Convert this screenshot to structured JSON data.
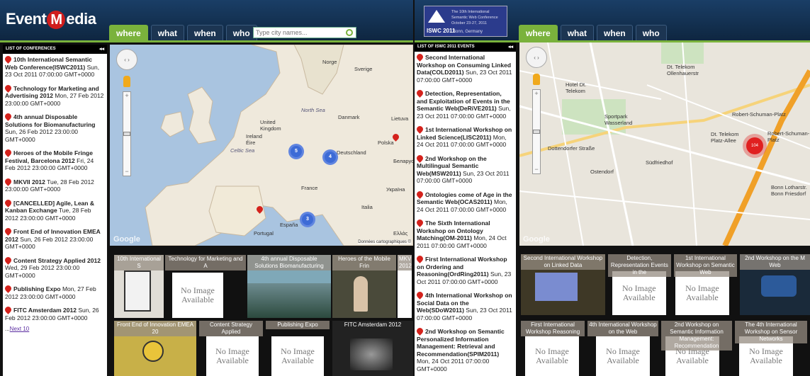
{
  "left": {
    "logo": {
      "pre": "Event",
      "heart": "M",
      "post": "edia"
    },
    "tabs": [
      "where",
      "what",
      "when",
      "who"
    ],
    "active_tab": "where",
    "search": {
      "placeholder": "Type city names..."
    },
    "list_header": "LIST OF CONFERENCES",
    "items": [
      {
        "title": "10th International Semantic Web Conference(ISWC2011)",
        "date": "Sun, 23 Oct 2011 07:00:00 GMT+0000"
      },
      {
        "title": "Technology for Marketing and Advertising 2012",
        "date": "Mon, 27 Feb 2012 23:00:00 GMT+0000"
      },
      {
        "title": "4th annual Disposable Solutions for Biomanufacturing",
        "date": "Sun, 26 Feb 2012 23:00:00 GMT+0000"
      },
      {
        "title": "Heroes of the Mobile Fringe Festival, Barcelona 2012",
        "date": "Fri, 24 Feb 2012 23:00:00 GMT+0000"
      },
      {
        "title": "MKVII 2012",
        "date": "Tue, 28 Feb 2012 23:00:00 GMT+0000"
      },
      {
        "title": "[CANCELLED] Agile, Lean & Kanban Exchange",
        "date": "Tue, 28 Feb 2012 23:00:00 GMT+0000"
      },
      {
        "title": "Front End of Innovation EMEA 2012",
        "date": "Sun, 26 Feb 2012 23:00:00 GMT+0000"
      },
      {
        "title": "Content Strategy Applied 2012",
        "date": "Wed, 29 Feb 2012 23:00:00 GMT+0000"
      },
      {
        "title": "Publishing Expo",
        "date": "Mon, 27 Feb 2012 23:00:00 GMT+0000"
      },
      {
        "title": "FITC Amsterdam 2012",
        "date": "Sun, 26 Feb 2012 23:00:00 GMT+0000"
      }
    ],
    "next_prefix": "...",
    "next_label": "Next 10",
    "map": {
      "google": "Google",
      "copyright": "Données cartographiques ©",
      "labels": [
        "Norge",
        "Sverige",
        "North Sea",
        "United Kingdom",
        "Ireland Éire",
        "Celtic Sea",
        "Danmark",
        "Deutschland",
        "Polska",
        "France",
        "Italia",
        "España",
        "Portugal",
        "Lietuva",
        "Беларусь",
        "Україна",
        "Ελλάς"
      ],
      "clusters": [
        "5",
        "4",
        "3"
      ]
    },
    "thumbs_row1": [
      "10th International S",
      "Technology for Marketing and A",
      "4th annual Disposable Solutions Biomanufacturing",
      "Heroes of the Mobile Frin",
      "MKV 2012"
    ],
    "thumbs_row2": [
      "Front End of Innovation EMEA 20",
      "Content Strategy Applied",
      "Publishing Expo",
      "FITC Amsterdam 2012"
    ],
    "no_image": "No Image Available"
  },
  "right": {
    "banner": {
      "label": "ISWC 2011",
      "line1": "The 10th International",
      "line2": "Semantic Web Conference",
      "line3": "October 23-27, 2011",
      "loc": "Bonn, Germany"
    },
    "tabs": [
      "where",
      "what",
      "when",
      "who"
    ],
    "active_tab": "where",
    "list_header": "LIST OF ISWC 2011 EVENTS",
    "items": [
      {
        "title": "Second International Workshop on Consuming Linked Data(COLD2011)",
        "date": "Sun, 23 Oct 2011 07:00:00 GMT+0000"
      },
      {
        "title": "Detection, Representation, and Exploitation of Events in the Semantic Web(DeRiVE2011)",
        "date": "Sun, 23 Oct 2011 07:00:00 GMT+0000"
      },
      {
        "title": "1st International Workshop on Linked Science(LISC2011)",
        "date": "Mon, 24 Oct 2011 07:00:00 GMT+0000"
      },
      {
        "title": "2nd Workshop on the Multilingual Semantic Web(MSW2011)",
        "date": "Sun, 23 Oct 2011 07:00:00 GMT+0000"
      },
      {
        "title": "Ontologies come of Age in the Semantic Web(OCAS2011)",
        "date": "Mon, 24 Oct 2011 07:00:00 GMT+0000"
      },
      {
        "title": "The Sixth International Workshop on Ontology Matching(OM-2011)",
        "date": "Mon, 24 Oct 2011 07:00:00 GMT+0000"
      },
      {
        "title": "First International Workshop on Ordering and Reasoning(OrdRing2011)",
        "date": "Sun, 23 Oct 2011 07:00:00 GMT+0000"
      },
      {
        "title": "4th International Workshop on Social Data on the Web(SDoW2011)",
        "date": "Sun, 23 Oct 2011 07:00:00 GMT+0000"
      },
      {
        "title": "2nd Workshop on Semantic Personalized Information Management: Retrieval and Recommendation(SPIM2011)",
        "date": "Mon, 24 Oct 2011 07:00:00 GMT+0000"
      }
    ],
    "map": {
      "google": "Google",
      "labels": [
        "Dt. Telekom Ollenhauerstr",
        "Hotel Dt. Telekom",
        "Sportpark Wasserland",
        "Robert-Schuman-Platz",
        "Dt. Telekom Platz-Allee",
        "Robert-Schuman-Platz",
        "Ostendorf",
        "Südfriedhof",
        "Bonn Lotharstr. Bonn Friesdorf",
        "Dottendorfer Straße"
      ],
      "red_cluster": "104"
    },
    "thumbs_row1": [
      "Second International Workshop on Linked Data",
      "Detection, Representation Events in the",
      "1st International Workshop on Semantic Web",
      "2nd Workshop on the M Web"
    ],
    "thumbs_row2": [
      "First International Workshop Reasoning",
      "4th International Workshop on the Web",
      "2nd Workshop on Semantic Information Management: Recommendation",
      "The 4th International Workshop on Sensor Networks"
    ],
    "no_image": "No Image Available"
  }
}
